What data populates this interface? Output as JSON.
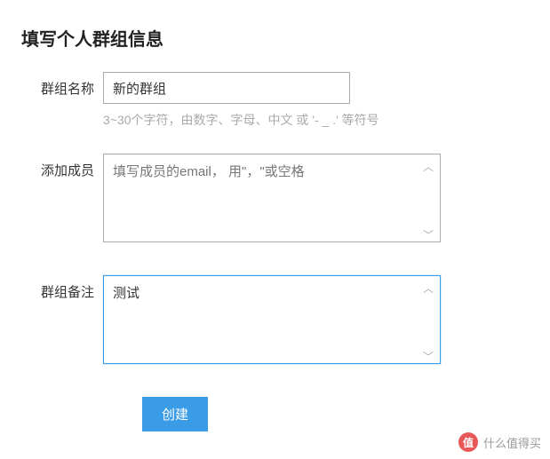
{
  "title": "填写个人群组信息",
  "fields": {
    "name": {
      "label": "群组名称",
      "value": "新的群组",
      "hint": "3~30个字符，由数字、字母、中文 或 '- _ .' 等符号"
    },
    "members": {
      "label": "添加成员",
      "placeholder": "填写成员的email， 用\"，\"或空格"
    },
    "remark": {
      "label": "群组备注",
      "value": "测试"
    }
  },
  "buttons": {
    "submit": "创建"
  },
  "watermark": {
    "icon": "值",
    "text": "什么值得买"
  }
}
